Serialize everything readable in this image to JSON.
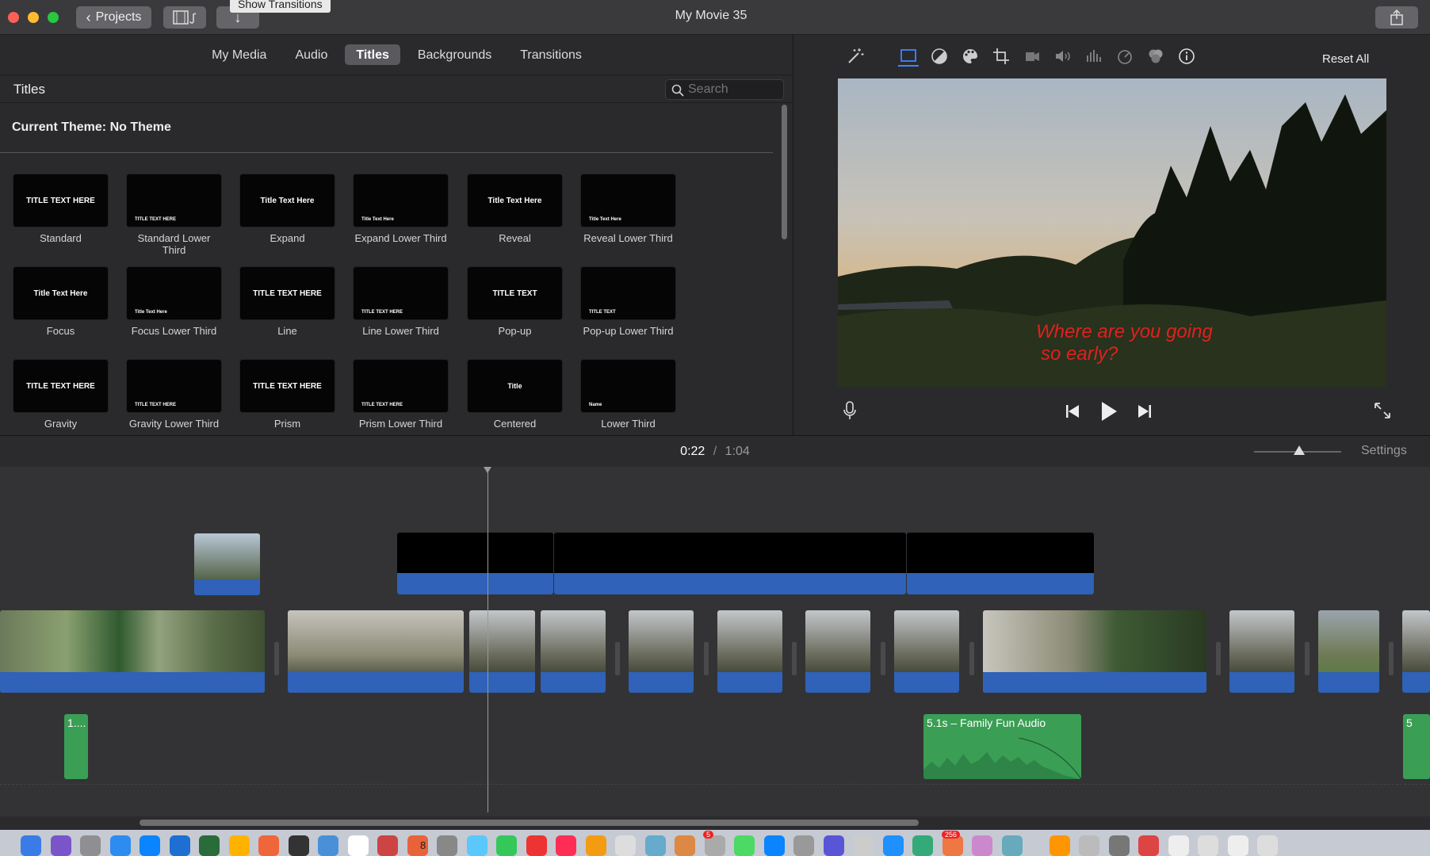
{
  "window": {
    "title": "My Movie 35",
    "projects_button": "Projects",
    "tooltip": "Show Transitions"
  },
  "browser": {
    "tabs": [
      "My Media",
      "Audio",
      "Titles",
      "Backgrounds",
      "Transitions"
    ],
    "active_tab": "Titles",
    "section_title": "Titles",
    "search_placeholder": "Search",
    "theme_label": "Current Theme: No Theme",
    "tiles": [
      {
        "label": "Standard",
        "preview": "TITLE TEXT HERE"
      },
      {
        "label": "Standard Lower Third",
        "preview": "TITLE TEXT HERE"
      },
      {
        "label": "Expand",
        "preview": "Title Text Here"
      },
      {
        "label": "Expand Lower Third",
        "preview": "Title Text Here"
      },
      {
        "label": "Reveal",
        "preview": "Title Text Here"
      },
      {
        "label": "Reveal Lower Third",
        "preview": "Title Text Here"
      },
      {
        "label": "Focus",
        "preview": "Title Text Here"
      },
      {
        "label": "Focus Lower Third",
        "preview": "Title Text Here"
      },
      {
        "label": "Line",
        "preview": "TITLE TEXT HERE"
      },
      {
        "label": "Line Lower Third",
        "preview": "TITLE TEXT HERE"
      },
      {
        "label": "Pop-up",
        "preview": "TITLE TEXT"
      },
      {
        "label": "Pop-up Lower Third",
        "preview": "TITLE TEXT"
      },
      {
        "label": "Gravity",
        "preview": "TITLE TEXT HERE"
      },
      {
        "label": "Gravity Lower Third",
        "preview": "TITLE TEXT HERE"
      },
      {
        "label": "Prism",
        "preview": "TITLE TEXT HERE"
      },
      {
        "label": "Prism Lower Third",
        "preview": "TITLE TEXT HERE"
      },
      {
        "label": "Centered",
        "preview": "Title"
      },
      {
        "label": "Lower Third",
        "preview": "Name"
      }
    ]
  },
  "viewer": {
    "reset_all": "Reset All",
    "caption_line1": "Where are you going",
    "caption_line2": "so early?",
    "tools": [
      "magic-wand-icon",
      "crop-to-fill-icon",
      "color-balance-icon",
      "color-correction-icon",
      "crop-icon",
      "stabilization-icon",
      "volume-icon",
      "equalizer-icon",
      "speed-icon",
      "filter-icon",
      "info-icon"
    ]
  },
  "timeline": {
    "current_time": "0:22",
    "separator": "/",
    "total_time": "1:04",
    "settings": "Settings",
    "audio_clips": [
      {
        "label": "1...."
      },
      {
        "label": "5.1s – Family Fun Audio"
      },
      {
        "label": "5"
      }
    ]
  },
  "colors": {
    "accent_blue": "#2f62b8",
    "audio_green": "#3b9e55",
    "caption_red": "#e12020"
  },
  "dock": {
    "calendar_day": "8",
    "badge_messages": "5",
    "badge_mail": "256"
  }
}
